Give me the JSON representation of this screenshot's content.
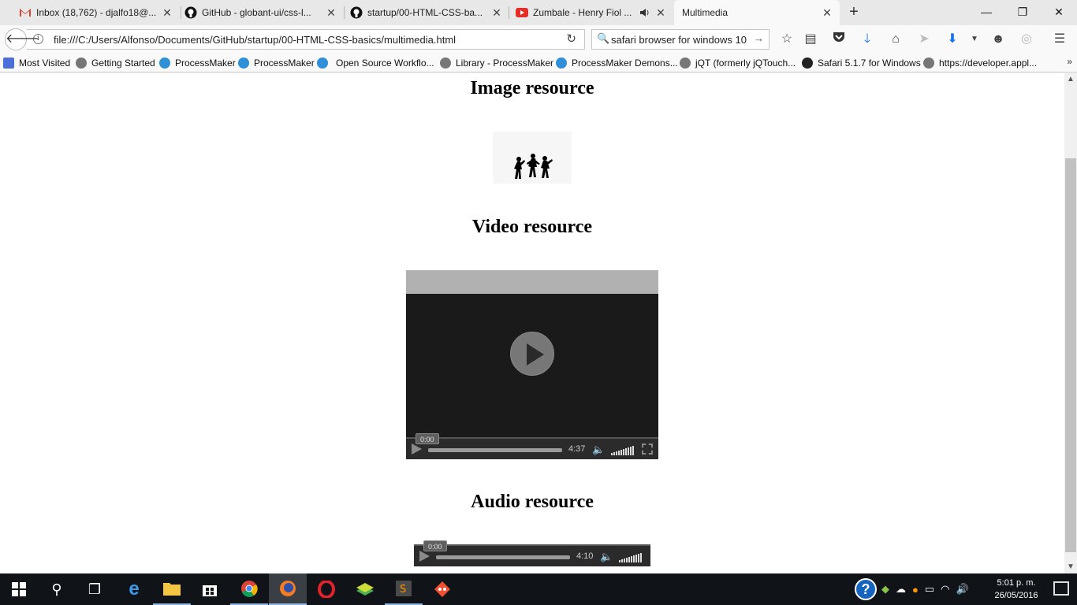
{
  "tabs": [
    {
      "title": "Inbox (18,762) - djalfo18@...",
      "icon": "gmail-icon",
      "color": "#d44638"
    },
    {
      "title": "GitHub - globant-ui/css-l...",
      "icon": "github-icon",
      "color": "#111111"
    },
    {
      "title": "startup/00-HTML-CSS-ba...",
      "icon": "github-icon",
      "color": "#111111"
    },
    {
      "title": "Zumbale - Henry Fiol ...",
      "icon": "youtube-icon",
      "color": "#e52d27"
    },
    {
      "title": "Multimedia",
      "icon": "",
      "active": true
    }
  ],
  "window_controls": {
    "minimize": "—",
    "restore": "❐",
    "close": "✕"
  },
  "navbar": {
    "url": "file:///C:/Users/Alfonso/Documents/GitHub/startup/00-HTML-CSS-basics/multimedia.html",
    "search_value": "safari browser for windows 10"
  },
  "bookmarks": [
    {
      "label": "Most Visited",
      "icon": "bookmarks-folder-icon",
      "color": "#4a6fd8"
    },
    {
      "label": "Getting Started",
      "icon": "globe-icon",
      "color": "#666666"
    },
    {
      "label": "ProcessMaker",
      "icon": "processmaker-icon",
      "color": "#2f8fd8"
    },
    {
      "label": "ProcessMaker",
      "icon": "processmaker-icon",
      "color": "#2f8fd8"
    },
    {
      "label": "Open Source Workflo...",
      "icon": "processmaker-icon",
      "color": "#2f8fd8"
    },
    {
      "label": "Library - ProcessMaker",
      "icon": "globe-icon",
      "color": "#666666"
    },
    {
      "label": "ProcessMaker Demons...",
      "icon": "processmaker-icon",
      "color": "#2f8fd8"
    },
    {
      "label": "jQT (formerly jQTouch...",
      "icon": "globe-icon",
      "color": "#666666"
    },
    {
      "label": "Safari 5.1.7 for Windows",
      "icon": "apple-icon",
      "color": "#222222"
    },
    {
      "label": "https://developer.appl...",
      "icon": "globe-icon",
      "color": "#666666"
    }
  ],
  "page": {
    "image_heading": "Image resource",
    "video_heading": "Video resource",
    "audio_heading": "Audio resource"
  },
  "video_player": {
    "current_time": "0:00",
    "duration": "4:37",
    "progress": 0
  },
  "audio_player": {
    "current_time": "0:00",
    "duration": "4:10",
    "progress": 0
  },
  "taskbar": {
    "apps": [
      "start-icon",
      "search-icon",
      "task-view-icon",
      "edge-icon",
      "file-explorer-icon",
      "store-icon",
      "chrome-icon",
      "firefox-icon",
      "opera-icon",
      "bluestacks-icon",
      "sublime-text-icon",
      "git-icon"
    ],
    "time": "5:01 p. m.",
    "date": "26/05/2016"
  }
}
